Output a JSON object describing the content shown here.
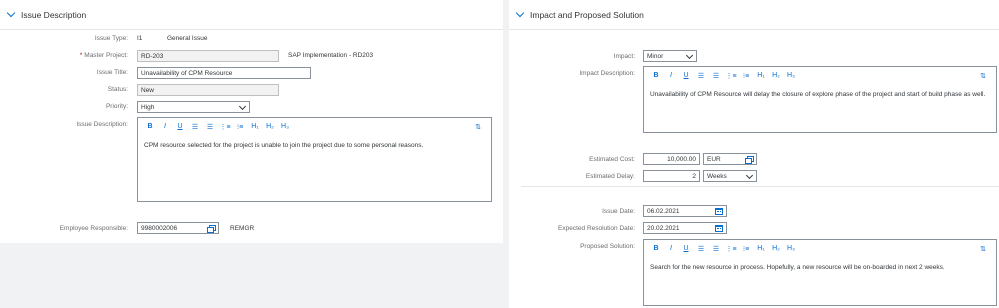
{
  "left": {
    "title": "Issue Description",
    "issue_type_label": "Issue Type:",
    "issue_type_code": "I1",
    "issue_type_text": "General Issue",
    "master_project_label": "Master Project:",
    "master_project_value": "RD-203",
    "master_project_text": "SAP Implementation - RD203",
    "issue_title_label": "Issue Title:",
    "issue_title_value": "Unavailability of CPM Resource",
    "status_label": "Status:",
    "status_value": "New",
    "priority_label": "Priority:",
    "priority_value": "High",
    "issue_desc_label": "Issue Description:",
    "issue_desc_text": "CPM resource selected for the project is unable to join the project due to some personal reasons.",
    "employee_label": "Employee Responsible:",
    "employee_value": "9980002006",
    "employee_text": "REMGR"
  },
  "right": {
    "title": "Impact and Proposed Solution",
    "impact_label": "Impact:",
    "impact_value": "Minor",
    "impact_desc_label": "Impact Description:",
    "impact_desc_text": "Unavailability of CPM Resource will delay the closure of explore phase of the project and start of build phase as well.",
    "est_cost_label": "Estimated Cost:",
    "est_cost_value": "10,000.00",
    "est_cost_currency": "EUR",
    "est_delay_label": "Estimated Delay:",
    "est_delay_value": "2",
    "est_delay_unit": "Weeks",
    "issue_date_label": "Issue Date:",
    "issue_date_value": "06.02.2021",
    "exp_res_label": "Expected Resolution Date:",
    "exp_res_value": "20.02.2021",
    "proposed_label": "Proposed Solution:",
    "proposed_text": "Search for the new resource in process. Hopefully, a new resource will be on-boarded in next 2 weeks."
  },
  "toolbar": {
    "bold": "B",
    "italic": "I",
    "underline": "U",
    "h1": "H₁",
    "h2": "H₂",
    "h3": "H₃"
  },
  "colors": {
    "accent": "#0a6ed1",
    "required": "#bb0000"
  },
  "icons": [
    "chevron-down-icon",
    "value-help-icon",
    "calendar-icon",
    "dropdown-arrow-icon"
  ]
}
